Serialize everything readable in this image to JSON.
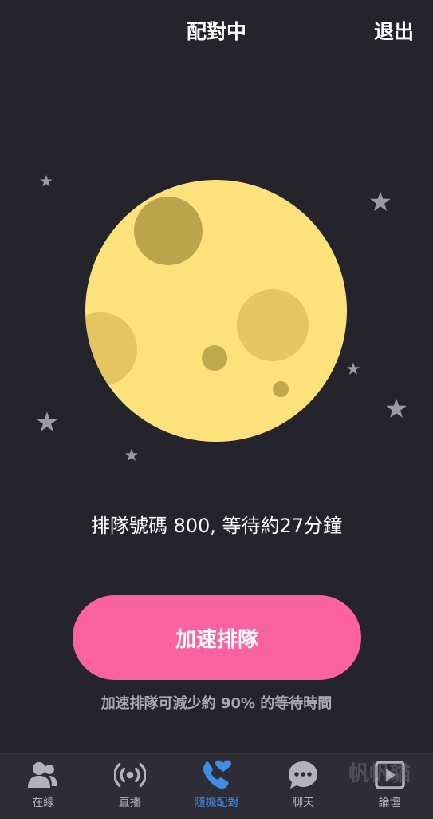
{
  "header": {
    "title": "配對中",
    "exit_label": "退出"
  },
  "queue": {
    "text": "排隊號碼 800, 等待約27分鐘"
  },
  "boost": {
    "button_label": "加速排隊",
    "hint": "加速排隊可減少約 90% 的等待時間"
  },
  "tabs": [
    {
      "label": "在線",
      "icon": "people-icon",
      "active": false
    },
    {
      "label": "直播",
      "icon": "broadcast-icon",
      "active": false
    },
    {
      "label": "隨機配對",
      "icon": "phone-heart-icon",
      "active": true
    },
    {
      "label": "聊天",
      "icon": "chat-bubble-icon",
      "active": false
    },
    {
      "label": "論壇",
      "icon": "play-square-icon",
      "active": false
    }
  ],
  "watermark": "帆帆貓",
  "colors": {
    "background": "#25242c",
    "moon": "#fde27b",
    "accent_pink": "#fa62a2",
    "active_tab": "#3f8ee6",
    "inactive_tab": "#b3b2b8"
  }
}
